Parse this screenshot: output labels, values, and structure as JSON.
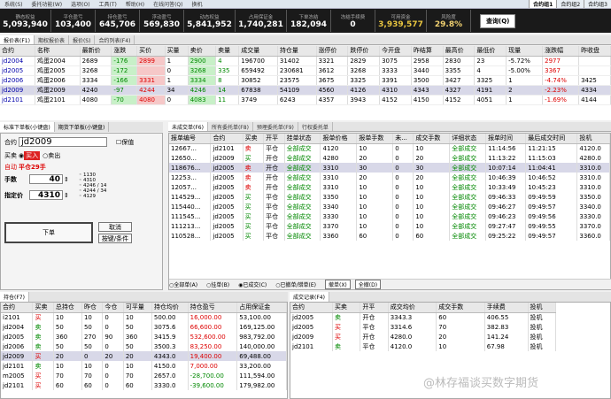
{
  "menu": {
    "items": [
      "系统(S)",
      "委托功能(W)",
      "选项(O)",
      "工具(T)",
      "帮助(H)",
      "在线问答(Q)",
      "换机"
    ],
    "right_tabs": [
      "合约组1",
      "合约组2",
      "合约组3"
    ]
  },
  "stats": [
    {
      "label": "静态权益",
      "value": "5,093,940"
    },
    {
      "label": "平仓盈亏",
      "value": "103,400"
    },
    {
      "label": "持仓盈亏",
      "value": "645,706"
    },
    {
      "label": "浮动盈亏",
      "value": "569,830"
    },
    {
      "label": "动态权益",
      "value": "5,841,952"
    },
    {
      "label": "占用保证金",
      "value": "1,740,281"
    },
    {
      "label": "下单冻结",
      "value": "182,094"
    },
    {
      "label": "冻结手续费",
      "value": "0"
    },
    {
      "label": "可用资金",
      "value": "3,939,577"
    },
    {
      "label": "风险度",
      "value": "29.8%"
    }
  ],
  "locked_button": "查询(Q)",
  "quote_tabs": [
    "报价表(F1)",
    "期权报价表",
    "报价(S)",
    "合约列表(F4)"
  ],
  "quote": {
    "headers": [
      "合约",
      "名称",
      "最新价",
      "涨跌",
      "买价",
      "买量",
      "卖价",
      "卖量",
      "成交量",
      "持仓量",
      "涨停价",
      "跌停价",
      "今开盘",
      "昨结算",
      "最高价",
      "最低价",
      "现量",
      "涨跌幅",
      "昨收盘"
    ],
    "rows": [
      [
        "jd2004",
        "鸡蛋2004",
        "2689",
        "-176",
        "2899",
        "1",
        "2900",
        "4",
        "196700",
        "31402",
        "3321",
        "2829",
        "3075",
        "2958",
        "2830",
        "23",
        "-5.72%",
        "2977",
        ""
      ],
      [
        "jd2005",
        "鸡蛋2005",
        "3268",
        "-172",
        "",
        "0",
        "3268",
        "335",
        "659492",
        "230681",
        "3612",
        "3268",
        "3333",
        "3440",
        "3355",
        "4",
        "-5.00%",
        "3367",
        ""
      ],
      [
        "jd2006",
        "鸡蛋2006",
        "3334",
        "-166",
        "3331",
        "1",
        "3334",
        "8",
        "30852",
        "23575",
        "3675",
        "3325",
        "3391",
        "3500",
        "3427",
        "3325",
        "1",
        "-4.74%",
        "3425"
      ],
      [
        "jd2009",
        "鸡蛋2009",
        "4240",
        "-97",
        "4244",
        "34",
        "4246",
        "14",
        "67838",
        "54109",
        "4560",
        "4126",
        "4310",
        "4343",
        "4327",
        "4191",
        "2",
        "-2.23%",
        "4334"
      ],
      [
        "jd2101",
        "鸡蛋2101",
        "4080",
        "-70",
        "4080",
        "0",
        "4083",
        "11",
        "3749",
        "6243",
        "4357",
        "3943",
        "4152",
        "4150",
        "4152",
        "4051",
        "1",
        "-1.69%",
        "4144"
      ]
    ]
  },
  "order_tabs": [
    "标准下单板(小键盘)",
    "期货下单板(小键盘)"
  ],
  "order": {
    "contract_label": "合约",
    "contract": "jd2009",
    "hedge_label": "保值",
    "buy_label": "买卖",
    "buy": "买入",
    "sell": "卖出",
    "open_label": "自动",
    "open_value": "平仓29手",
    "qty_label": "手数",
    "qty": "40",
    "price_label": "指定价",
    "price": "4310",
    "side_nums": [
      "1130",
      "4310",
      "4246",
      "4244",
      "4129"
    ],
    "side_nums2": [
      "14",
      "34"
    ],
    "submit": "下单",
    "cancel": "取消",
    "cond": "按键/条件"
  },
  "trade_tabs": [
    "未成交单(F6)",
    "所有委托单(F8)",
    "预埋委托单(F9)",
    "行权委托单"
  ],
  "trade": {
    "headers": [
      "报单编号",
      "合约",
      "买卖",
      "开平",
      "挂单状态",
      "报单价格",
      "报单手数",
      "未...",
      "成交手数",
      "详细状态",
      "报单时间",
      "最后成交时间",
      "投机"
    ],
    "rows": [
      [
        "12667...",
        "jd2101",
        "卖",
        "平仓",
        "全部成交",
        "4120",
        "10",
        "0",
        "10",
        "全部成交",
        "11:14:56",
        "11:21:15",
        "4120.0"
      ],
      [
        "12650...",
        "jd2009",
        "买",
        "开仓",
        "全部成交",
        "4280",
        "20",
        "0",
        "20",
        "全部成交",
        "11:13:22",
        "11:15:03",
        "4280.0"
      ],
      [
        "118676...",
        "jd2005",
        "卖",
        "开仓",
        "全部成交",
        "3310",
        "30",
        "0",
        "30",
        "全部成交",
        "10:07:14",
        "11:04:41",
        "3310.0"
      ],
      [
        "12253...",
        "jd2005",
        "卖",
        "开仓",
        "全部成交",
        "3310",
        "20",
        "0",
        "20",
        "全部成交",
        "10:46:39",
        "10:46:52",
        "3310.0"
      ],
      [
        "12057...",
        "jd2005",
        "卖",
        "开仓",
        "全部成交",
        "3310",
        "10",
        "0",
        "10",
        "全部成交",
        "10:33:49",
        "10:45:23",
        "3310.0"
      ],
      [
        "114529...",
        "jd2005",
        "买",
        "平仓",
        "全部成交",
        "3350",
        "10",
        "0",
        "10",
        "全部成交",
        "09:46:33",
        "09:49:59",
        "3350.0"
      ],
      [
        "115440...",
        "jd2005",
        "买",
        "平仓",
        "全部成交",
        "3340",
        "10",
        "0",
        "10",
        "全部成交",
        "09:46:27",
        "09:49:57",
        "3340.0"
      ],
      [
        "111545...",
        "jd2005",
        "买",
        "平仓",
        "全部成交",
        "3330",
        "10",
        "0",
        "10",
        "全部成交",
        "09:46:23",
        "09:49:56",
        "3330.0"
      ],
      [
        "111213...",
        "jd2005",
        "买",
        "平仓",
        "全部成交",
        "3370",
        "10",
        "0",
        "10",
        "全部成交",
        "09:27:47",
        "09:49:55",
        "3370.0"
      ],
      [
        "110528...",
        "jd2005",
        "买",
        "平仓",
        "全部成交",
        "3360",
        "60",
        "0",
        "60",
        "全部成交",
        "09:25:22",
        "09:49:57",
        "3360.0"
      ]
    ],
    "radios": [
      "全部单(A)",
      "挂单(B)",
      "已成交(C)",
      "已撤单/错单(E)"
    ],
    "btn_cancel": "撤单(X)",
    "btn_all": "全撤(D)"
  },
  "pos_tab": "持仓(F7)",
  "positions": {
    "headers": [
      "合约",
      "买卖",
      "总持仓",
      "昨仓",
      "今仓",
      "可平量",
      "持仓均价",
      "持仓盈亏",
      "占用保证金"
    ],
    "rows": [
      [
        "i2101",
        "买",
        "10",
        "10",
        "0",
        "10",
        "500.00",
        "16,000.00",
        "53,100.00"
      ],
      [
        "jd2004",
        "卖",
        "50",
        "50",
        "0",
        "50",
        "3075.6",
        "66,600.00",
        "169,125.00"
      ],
      [
        "jd2005",
        "卖",
        "360",
        "270",
        "90",
        "360",
        "3415.9",
        "532,600.00",
        "983,792.00"
      ],
      [
        "jd2006",
        "卖",
        "50",
        "50",
        "0",
        "50",
        "3500.3",
        "83,250.00",
        "140,000.00"
      ],
      [
        "jd2009",
        "买",
        "20",
        "0",
        "20",
        "20",
        "4343.0",
        "19,400.00",
        "69,488.00"
      ],
      [
        "jd2101",
        "卖",
        "10",
        "10",
        "0",
        "10",
        "4150.0",
        "7,000.00",
        "33,200.00"
      ],
      [
        "m2005",
        "买",
        "70",
        "70",
        "0",
        "70",
        "2657.0",
        "-28,700.00",
        "111,594.00"
      ],
      [
        "jd2101",
        "买",
        "60",
        "60",
        "0",
        "60",
        "3330.0",
        "-39,600.00",
        "179,982.00"
      ]
    ]
  },
  "deal_tab": "成交记录(F4)",
  "deals": {
    "headers": [
      "合约",
      "买卖",
      "开平",
      "成交均价",
      "成交手数",
      "手续费",
      "投机"
    ],
    "rows": [
      [
        "jd2005",
        "卖",
        "开仓",
        "3343.3",
        "60",
        "406.55",
        "投机"
      ],
      [
        "jd2005",
        "买",
        "平仓",
        "3314.6",
        "70",
        "382.83",
        "投机"
      ],
      [
        "jd2009",
        "买",
        "开仓",
        "4280.0",
        "20",
        "141.24",
        "投机"
      ],
      [
        "jd2101",
        "卖",
        "平仓",
        "4120.0",
        "10",
        "67.98",
        "投机"
      ]
    ]
  },
  "watermark": "@林存福谈买数字期货"
}
